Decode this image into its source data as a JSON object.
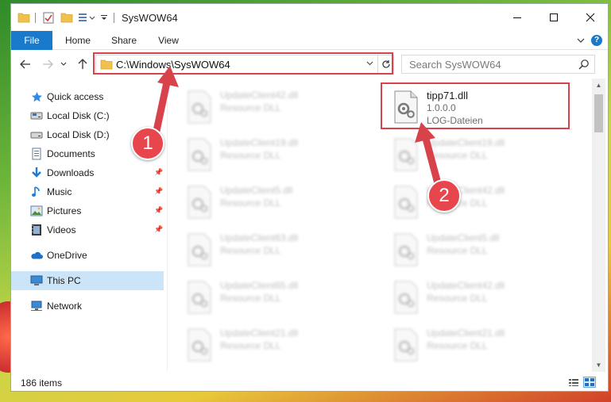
{
  "window": {
    "title": "SysWOW64",
    "quick_access_toolbar": [
      "folder-icon",
      "properties-check-icon",
      "new-folder-icon",
      "customize-icon"
    ]
  },
  "ribbon": {
    "tabs": [
      "File",
      "Home",
      "Share",
      "View"
    ],
    "accent": "#1979ca"
  },
  "address": {
    "path": "C:\\Windows\\SysWOW64",
    "search_placeholder": "Search SysWOW64"
  },
  "nav_pane": {
    "items": [
      {
        "label": "Quick access",
        "icon": "star-icon"
      },
      {
        "label": "Local Disk (C:)",
        "icon": "drive-icon"
      },
      {
        "label": "Local Disk (D:)",
        "icon": "drive-icon"
      },
      {
        "label": "Documents",
        "icon": "documents-icon"
      },
      {
        "label": "Downloads",
        "icon": "download-icon",
        "pinned": true
      },
      {
        "label": "Music",
        "icon": "music-icon",
        "pinned": true
      },
      {
        "label": "Pictures",
        "icon": "pictures-icon",
        "pinned": true
      },
      {
        "label": "Videos",
        "icon": "videos-icon",
        "pinned": true
      },
      {
        "label": "OneDrive",
        "icon": "cloud-icon"
      },
      {
        "label": "This PC",
        "icon": "pc-icon",
        "selected": true
      },
      {
        "label": "Network",
        "icon": "network-icon"
      }
    ]
  },
  "files": {
    "highlighted": {
      "name": "tipp71.dll",
      "version": "1.0.0.0",
      "type": "LOG-Dateien"
    },
    "left_column": [
      {
        "name": "UpdateClient42.dll",
        "type": "Resource DLL"
      },
      {
        "name": "UpdateClient19.dll",
        "type": "Resource DLL"
      },
      {
        "name": "UpdateClient5.dll",
        "type": "Resource DLL"
      },
      {
        "name": "UpdateClient63.dll",
        "type": "Resource DLL"
      },
      {
        "name": "UpdateClient65.dll",
        "type": "Resource DLL"
      },
      {
        "name": "UpdateClient21.dll",
        "type": "Resource DLL"
      }
    ],
    "right_column": [
      {
        "name": "UpdateClient19.dll",
        "type": "Resource DLL"
      },
      {
        "name": "UpdateClient42.dll",
        "type": "Resource DLL"
      },
      {
        "name": "UpdateClient5.dll",
        "type": "Resource DLL"
      },
      {
        "name": "UpdateClient42.dll",
        "type": "Resource DLL"
      },
      {
        "name": "UpdateClient21.dll",
        "type": "Resource DLL"
      }
    ]
  },
  "status": {
    "item_count": "186 items"
  },
  "annotations": {
    "step1": "1",
    "step2": "2",
    "color": "#d8434b"
  }
}
